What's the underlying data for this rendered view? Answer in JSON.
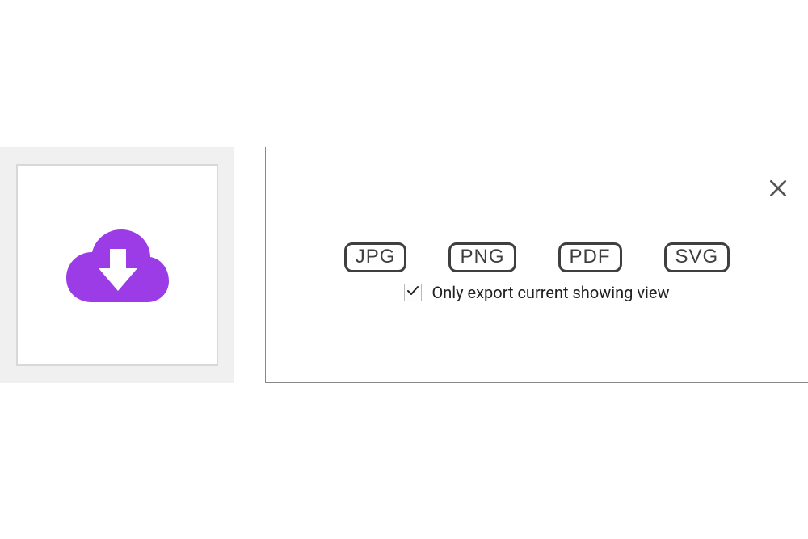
{
  "download_tile": {
    "icon": "cloud-download-icon"
  },
  "export_panel": {
    "formats": [
      "JPG",
      "PNG",
      "PDF",
      "SVG"
    ],
    "checkbox_label": "Only export current showing view",
    "checkbox_checked": true
  }
}
